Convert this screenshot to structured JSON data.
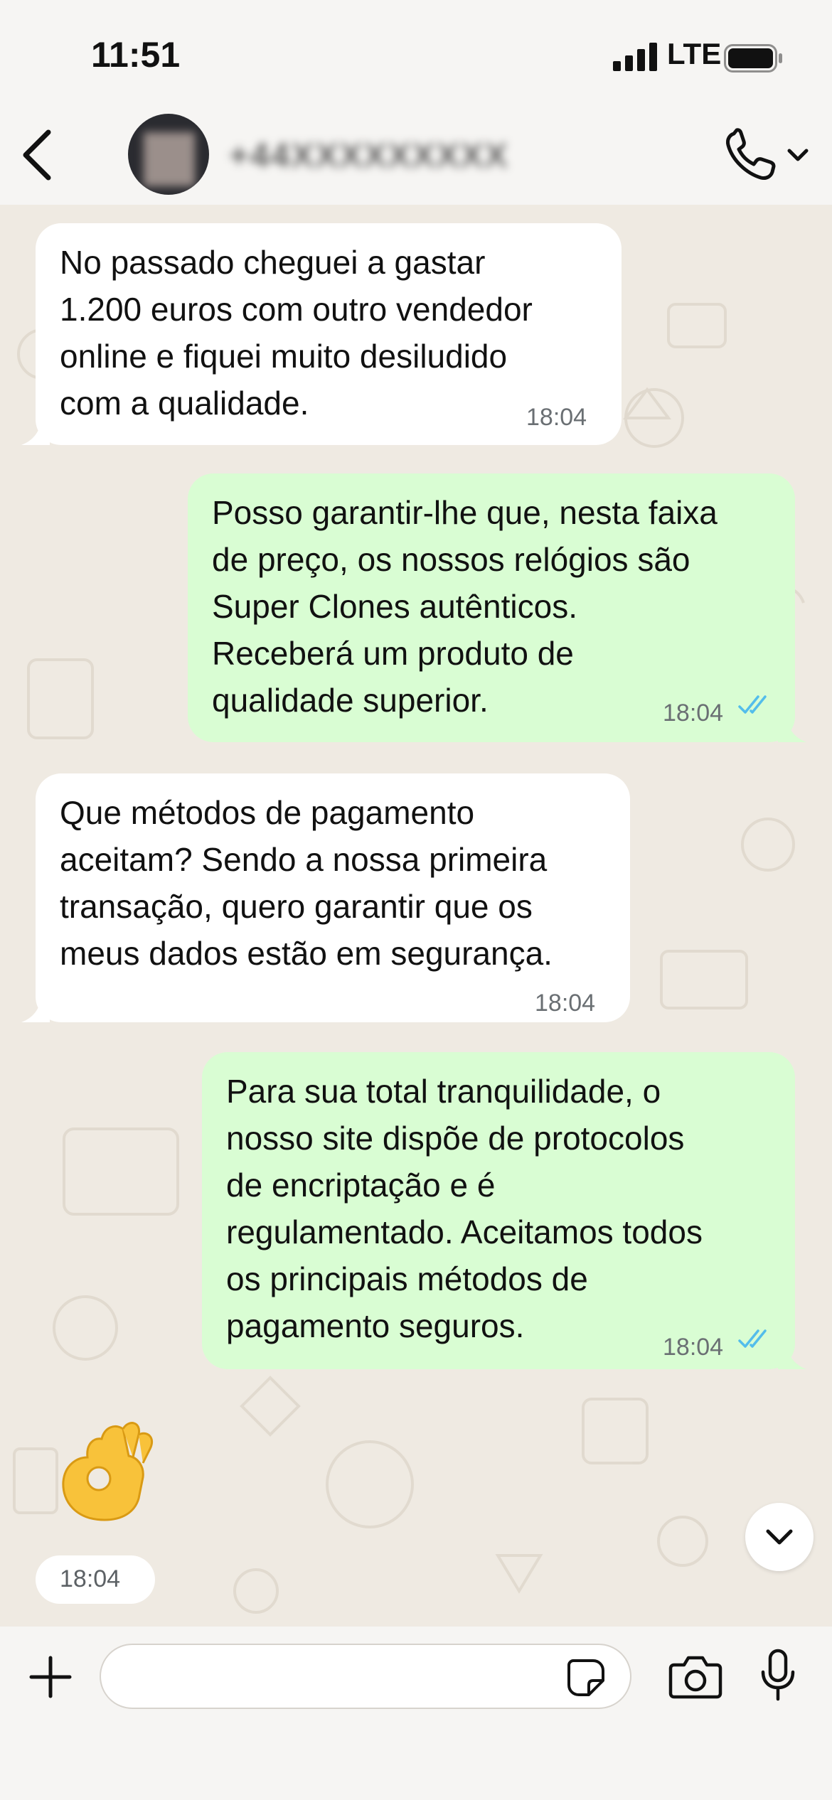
{
  "status_bar": {
    "time": "11:51",
    "network": "LTE"
  },
  "header": {
    "contact_name": "+44XXXXXXXXX",
    "call_menu": "call-dropdown"
  },
  "messages": [
    {
      "direction": "incoming",
      "text": "No passado cheguei a gastar\n1.200 euros com outro vendedor\nonline e fiquei muito desiludido\ncom a qualidade.",
      "time": "18:04"
    },
    {
      "direction": "outgoing",
      "text": "Posso garantir-lhe que, nesta faixa\nde preço, os nossos relógios são\nSuper Clones autênticos.\nReceberá um produto de\nqualidade superior.",
      "time": "18:04",
      "status": "read"
    },
    {
      "direction": "incoming",
      "text": "Que métodos de pagamento\naceitam? Sendo a nossa primeira\ntransação, quero garantir que os\nmeus dados estão em segurança.",
      "time": "18:04"
    },
    {
      "direction": "outgoing",
      "text": "Para sua total tranquilidade, o\nnosso site dispõe de protocolos\nde encriptação e é\nregulamentado. Aceitamos todos\nos principais métodos de\npagamento seguros.",
      "time": "18:04",
      "status": "read"
    },
    {
      "direction": "incoming",
      "emoji": "👌",
      "time": "18:04"
    }
  ],
  "composer": {
    "placeholder": ""
  },
  "colors": {
    "incoming_bubble": "#ffffff",
    "outgoing_bubble": "#d9fdd3",
    "read_ticks": "#53bdeb",
    "chat_bg": "#efeae2"
  }
}
